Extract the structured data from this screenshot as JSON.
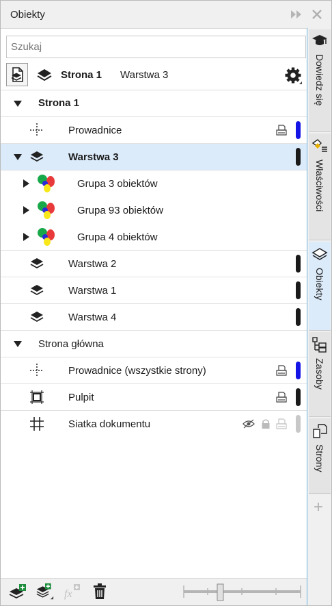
{
  "panel": {
    "title": "Obiekty",
    "search_placeholder": "Szukaj"
  },
  "toolbar": {
    "page_label": "Strona 1",
    "layer_label": "Warstwa 3"
  },
  "tree": {
    "page1": {
      "label": "Strona 1"
    },
    "guides": {
      "label": "Prowadnice",
      "color": "#1414e6"
    },
    "layer3": {
      "label": "Warstwa 3",
      "color": "#1a1a1a"
    },
    "groups": [
      {
        "label": "Grupa 3 obiektów"
      },
      {
        "label": "Grupa 93 obiektów"
      },
      {
        "label": "Grupa 4 obiektów"
      }
    ],
    "layer2": {
      "label": "Warstwa 2",
      "color": "#1a1a1a"
    },
    "layer1": {
      "label": "Warstwa 1",
      "color": "#1a1a1a"
    },
    "layer4": {
      "label": "Warstwa 4",
      "color": "#1a1a1a"
    },
    "master": {
      "label": "Strona główna"
    },
    "master_guides": {
      "label": "Prowadnice (wszystkie strony)",
      "color": "#1414e6"
    },
    "desktop": {
      "label": "Pulpit",
      "color": "#1a1a1a"
    },
    "grid": {
      "label": "Siatka dokumentu",
      "color": "#c8c8c8"
    }
  },
  "side_tabs": [
    {
      "label": "Dowiedz się"
    },
    {
      "label": "Właściwości"
    },
    {
      "label": "Obiekty"
    },
    {
      "label": "Zasoby"
    },
    {
      "label": "Strony"
    }
  ]
}
